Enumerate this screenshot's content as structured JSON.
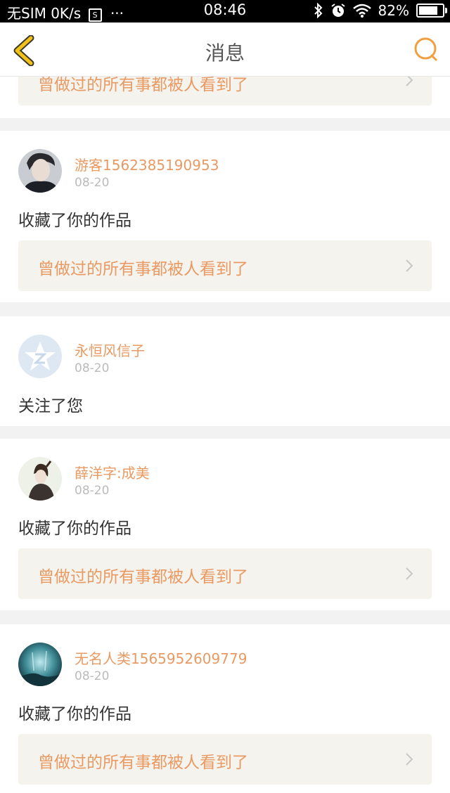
{
  "status_bar": {
    "carrier": "无SIM 0K/s",
    "sim_icon_text": "S",
    "dots": "···",
    "time": "08:46",
    "battery_percent": "82%",
    "battery_level": 0.82
  },
  "nav": {
    "title": "消息",
    "accent_color": "#f0a040"
  },
  "messages": [
    {
      "username": "",
      "date": "",
      "action": "",
      "work_title": "曾做过的所有事都被人看到了"
    },
    {
      "username": "游客1562385190953",
      "date": "08-20",
      "action": "收藏了你的作品",
      "work_title": "曾做过的所有事都被人看到了"
    },
    {
      "username": "永恒风信子",
      "date": "08-20",
      "action": "关注了您",
      "work_title": ""
    },
    {
      "username": "薛洋字:成美",
      "date": "08-20",
      "action": "收藏了你的作品",
      "work_title": "曾做过的所有事都被人看到了"
    },
    {
      "username": "无名人类1565952609779",
      "date": "08-20",
      "action": "收藏了你的作品",
      "work_title": "曾做过的所有事都被人看到了"
    }
  ]
}
